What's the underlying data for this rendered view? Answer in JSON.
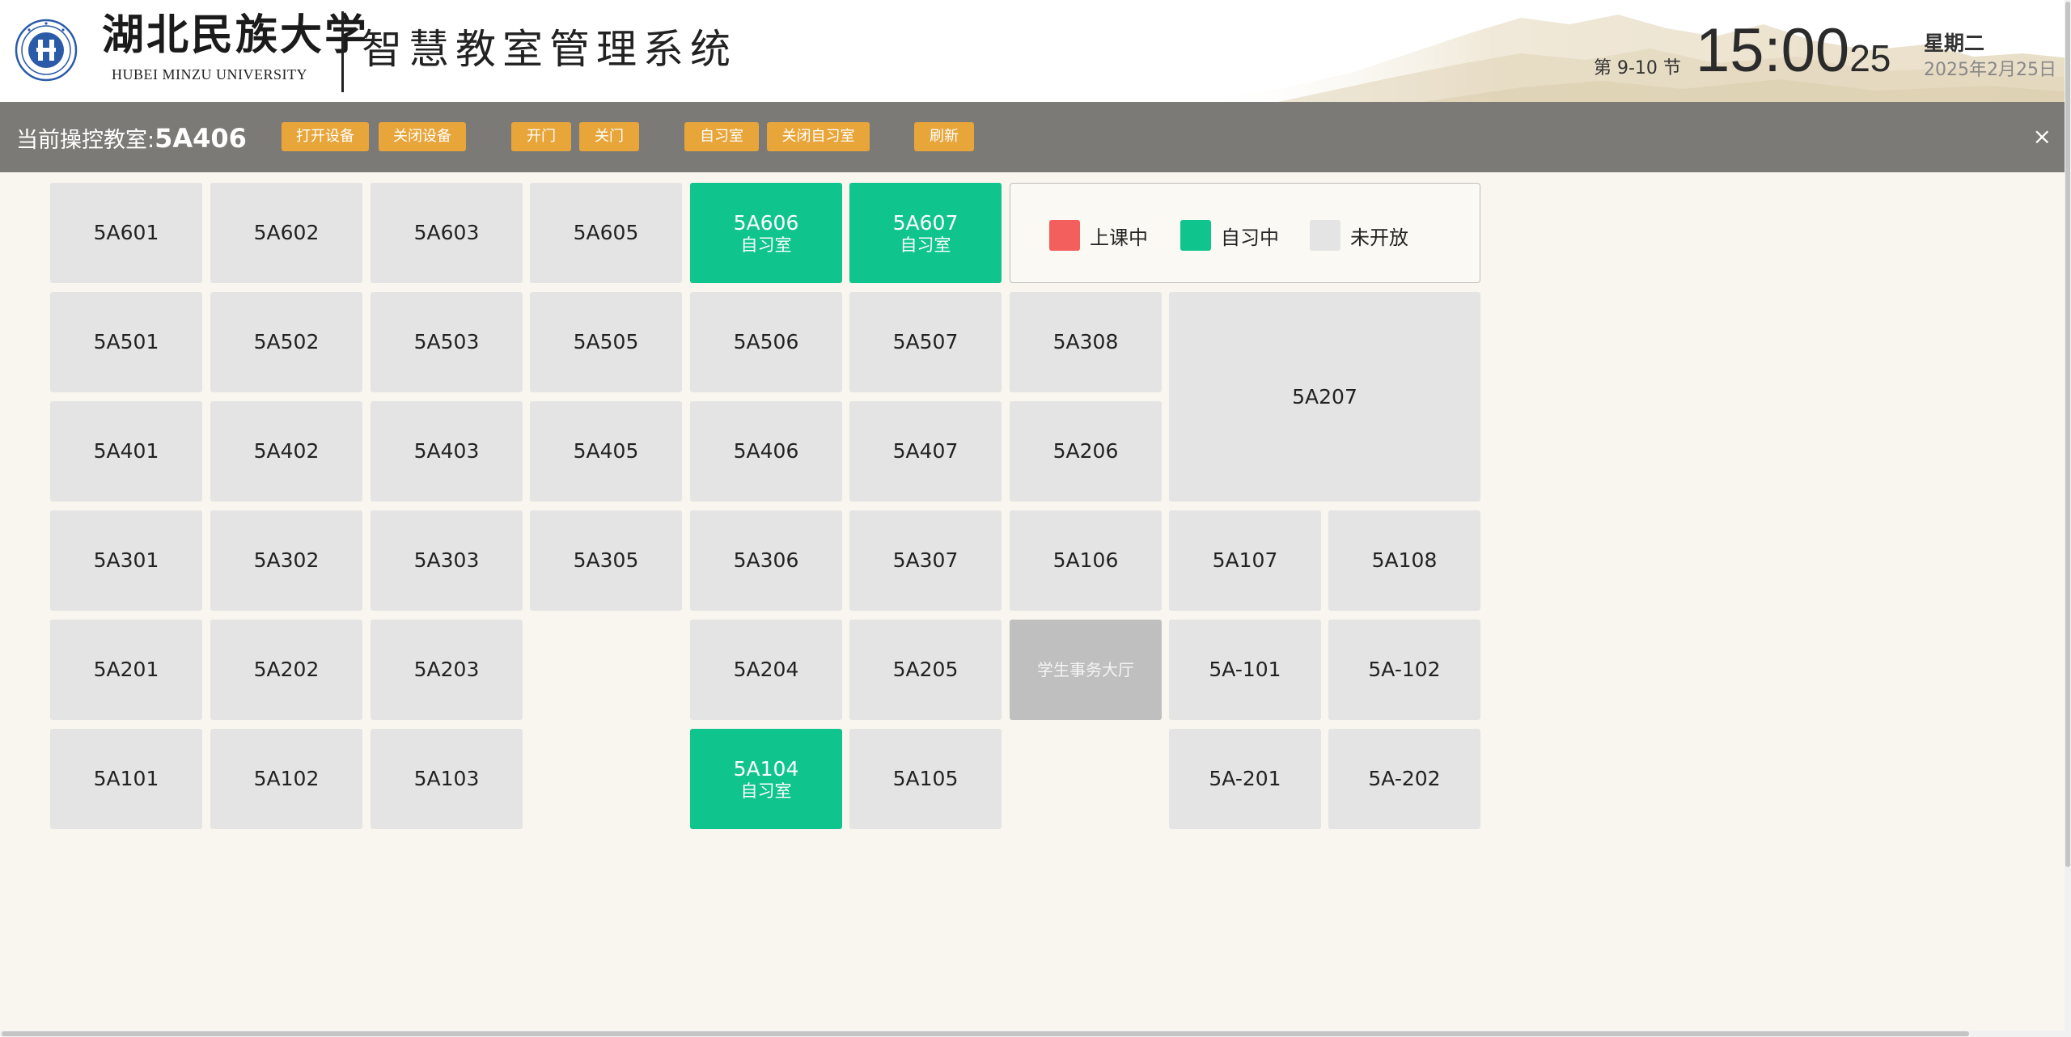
{
  "header": {
    "university_name_cn": "湖北民族大学",
    "university_name_en": "HUBEI MINZU UNIVERSITY",
    "system_title": "智慧教室管理系统",
    "period": "第 9-10 节",
    "time_hm": "15:00",
    "time_seconds": "25",
    "weekday": "星期二",
    "date": "2025年2月25日",
    "logo_icon": "university-seal-icon"
  },
  "toolbar": {
    "current_room_label": "当前操控教室:",
    "current_room": "5A406",
    "buttons": {
      "open_device": "打开设备",
      "close_device": "关闭设备",
      "open_door": "开门",
      "close_door": "关门",
      "self_study": "自习室",
      "close_self_study": "关闭自习室",
      "refresh": "刷新"
    },
    "close_icon": "×",
    "button_color": "#e8a53a",
    "bar_color": "#7b7a76"
  },
  "status_colors": {
    "in_class": "#f25f5c",
    "self_study": "#10c48e",
    "closed": "#e4e4e4"
  },
  "legend": {
    "in_class": "上课中",
    "self_study": "自习中",
    "closed": "未开放"
  },
  "rooms": {
    "r5A601": {
      "name": "5A601"
    },
    "r5A602": {
      "name": "5A602"
    },
    "r5A603": {
      "name": "5A603"
    },
    "r5A605": {
      "name": "5A605"
    },
    "r5A606": {
      "name": "5A606",
      "status": "自习室"
    },
    "r5A607": {
      "name": "5A607",
      "status": "自习室"
    },
    "r5A501": {
      "name": "5A501"
    },
    "r5A502": {
      "name": "5A502"
    },
    "r5A503": {
      "name": "5A503"
    },
    "r5A505": {
      "name": "5A505"
    },
    "r5A506": {
      "name": "5A506"
    },
    "r5A507": {
      "name": "5A507"
    },
    "r5A308": {
      "name": "5A308"
    },
    "r5A207": {
      "name": "5A207"
    },
    "r5A401": {
      "name": "5A401"
    },
    "r5A402": {
      "name": "5A402"
    },
    "r5A403": {
      "name": "5A403"
    },
    "r5A405": {
      "name": "5A405"
    },
    "r5A406": {
      "name": "5A406"
    },
    "r5A407": {
      "name": "5A407"
    },
    "r5A206": {
      "name": "5A206"
    },
    "r5A301": {
      "name": "5A301"
    },
    "r5A302": {
      "name": "5A302"
    },
    "r5A303": {
      "name": "5A303"
    },
    "r5A305": {
      "name": "5A305"
    },
    "r5A306": {
      "name": "5A306"
    },
    "r5A307": {
      "name": "5A307"
    },
    "r5A106": {
      "name": "5A106"
    },
    "r5A107": {
      "name": "5A107"
    },
    "r5A108": {
      "name": "5A108"
    },
    "r5A201": {
      "name": "5A201"
    },
    "r5A202": {
      "name": "5A202"
    },
    "r5A203": {
      "name": "5A203"
    },
    "r5A204": {
      "name": "5A204"
    },
    "r5A205": {
      "name": "5A205"
    },
    "hall": {
      "name": "学生事务大厅"
    },
    "r5Am101": {
      "name": "5A-101"
    },
    "r5Am102": {
      "name": "5A-102"
    },
    "r5A101": {
      "name": "5A101"
    },
    "r5A102": {
      "name": "5A102"
    },
    "r5A103": {
      "name": "5A103"
    },
    "r5A104": {
      "name": "5A104",
      "status": "自习室"
    },
    "r5A105": {
      "name": "5A105"
    },
    "r5Am201": {
      "name": "5A-201"
    },
    "r5Am202": {
      "name": "5A-202"
    }
  }
}
